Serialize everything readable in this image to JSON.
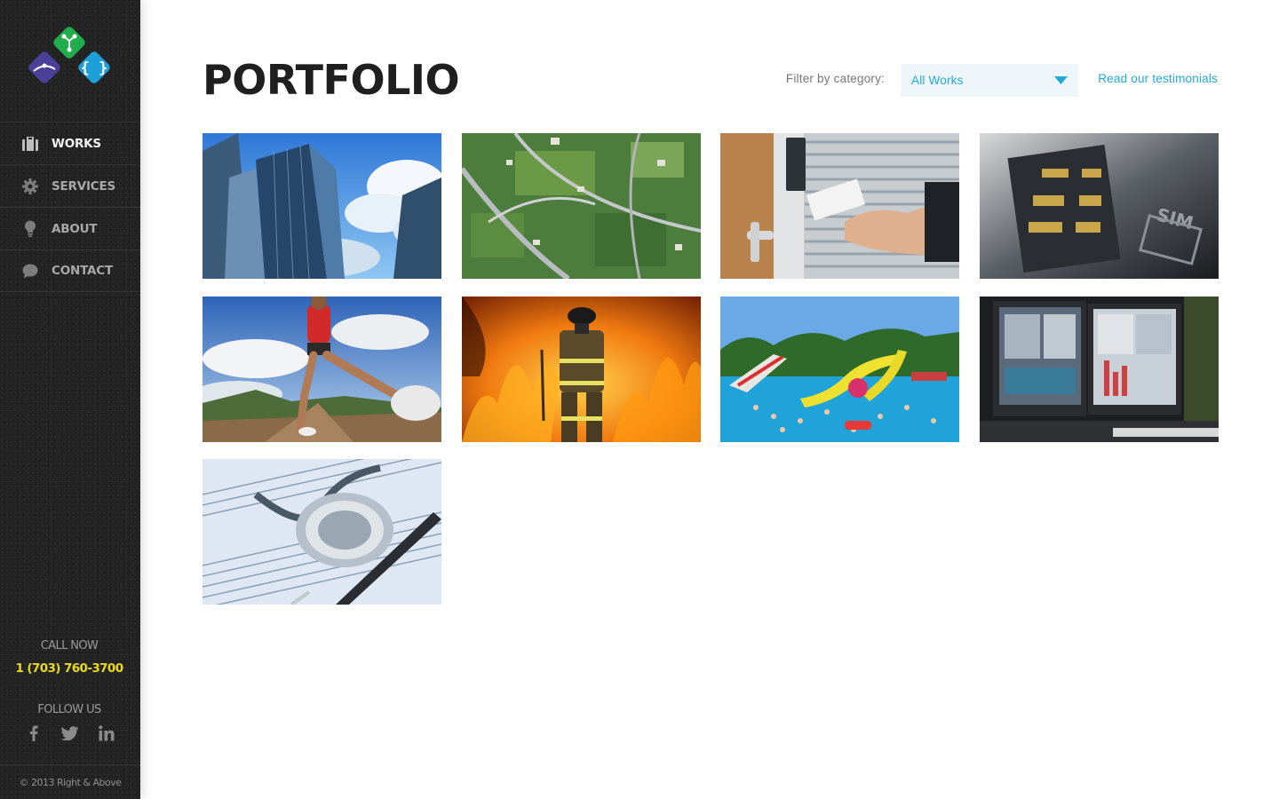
{
  "sidebar": {
    "nav": [
      {
        "label": "WORKS",
        "icon": "briefcase-icon",
        "active": true
      },
      {
        "label": "SERVICES",
        "icon": "gear-icon",
        "active": false
      },
      {
        "label": "ABOUT",
        "icon": "lightbulb-icon",
        "active": false
      },
      {
        "label": "CONTACT",
        "icon": "speech-bubble-icon",
        "active": false
      }
    ],
    "call_label": "CALL NOW",
    "phone": "1 (703) 760-3700",
    "follow_label": "FOLLOW US",
    "social": [
      "facebook-icon",
      "twitter-icon",
      "linkedin-icon"
    ],
    "copyright": "© 2013 Right & Above",
    "colors": {
      "background": "#232323",
      "phone": "#eadb1a",
      "logo_green": "#1fae4b",
      "logo_blue": "#1d9fd8",
      "logo_purple": "#4b3f98"
    }
  },
  "main": {
    "title": "PORTFOLIO",
    "filter": {
      "label": "Filter by category:",
      "selected": "All Works"
    },
    "testimonials_link": "Read our testimonials",
    "accent": "#21a9dc",
    "tiles": [
      {
        "subject": "skyscrapers"
      },
      {
        "subject": "aerial-map"
      },
      {
        "subject": "keycard-access"
      },
      {
        "subject": "sim-card"
      },
      {
        "subject": "runner"
      },
      {
        "subject": "firefighter"
      },
      {
        "subject": "water-park"
      },
      {
        "subject": "computer-monitors"
      },
      {
        "subject": "stethoscope"
      }
    ]
  }
}
